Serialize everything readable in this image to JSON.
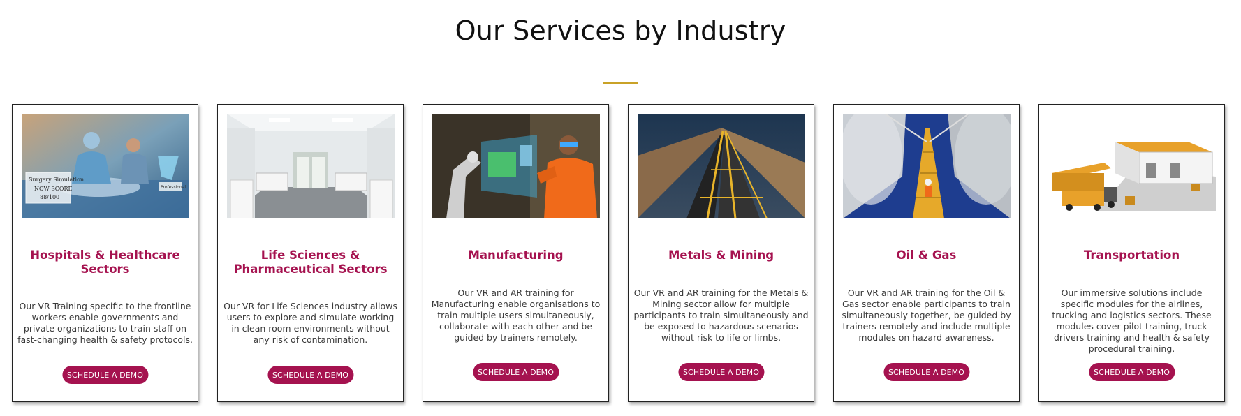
{
  "section": {
    "title": "Our Services by Industry",
    "accent_color": "#c9a227",
    "brand_color": "#a5124f"
  },
  "cards": [
    {
      "title": "Hospitals & Healthcare Sectors",
      "text": "Our VR Training specific to the frontline workers enable governments and private organizations to train staff on fast-changing health & safety protocols.",
      "cta": "SCHEDULE A DEMO",
      "image": "surgery-vr-image"
    },
    {
      "title": "Life Sciences & Pharmaceutical Sectors",
      "text": "Our VR for Life Sciences industry allows users to explore and simulate working in clean room environments without any risk of contamination.",
      "cta": "SCHEDULE A DEMO",
      "image": "clean-room-lab-image"
    },
    {
      "title": "Manufacturing",
      "text": "Our VR and AR training for Manufacturing enable organisations to train multiple users simultaneously, collaborate with each other and be guided by trainers remotely.",
      "cta": "SCHEDULE A DEMO",
      "image": "ar-robot-arm-image"
    },
    {
      "title": "Metals & Mining",
      "text": "Our VR and AR training for the Metals & Mining sector allow for multiple participants to train simultaneously and be exposed to hazardous scenarios without risk to life or limbs.",
      "cta": "SCHEDULE A DEMO",
      "image": "mining-conveyor-image"
    },
    {
      "title": "Oil & Gas",
      "text": "Our VR and AR training for the Oil & Gas sector enable participants to train simultaneously together, be guided by trainers remotely and include multiple modules on hazard awareness.",
      "cta": "SCHEDULE A DEMO",
      "image": "oil-gas-tanks-image"
    },
    {
      "title": "Transportation",
      "text": "Our immersive solutions include specific modules for the airlines, trucking and logistics sectors. These modules cover pilot training, truck drivers training and health & safety procedural training.",
      "cta": "SCHEDULE A DEMO",
      "image": "trucks-warehouse-image"
    }
  ],
  "image_overlays": {
    "surgery_label": "Surgery Simulation",
    "score_label": "NOW SCORE",
    "score_value": "88/100",
    "badge": "Professional"
  }
}
